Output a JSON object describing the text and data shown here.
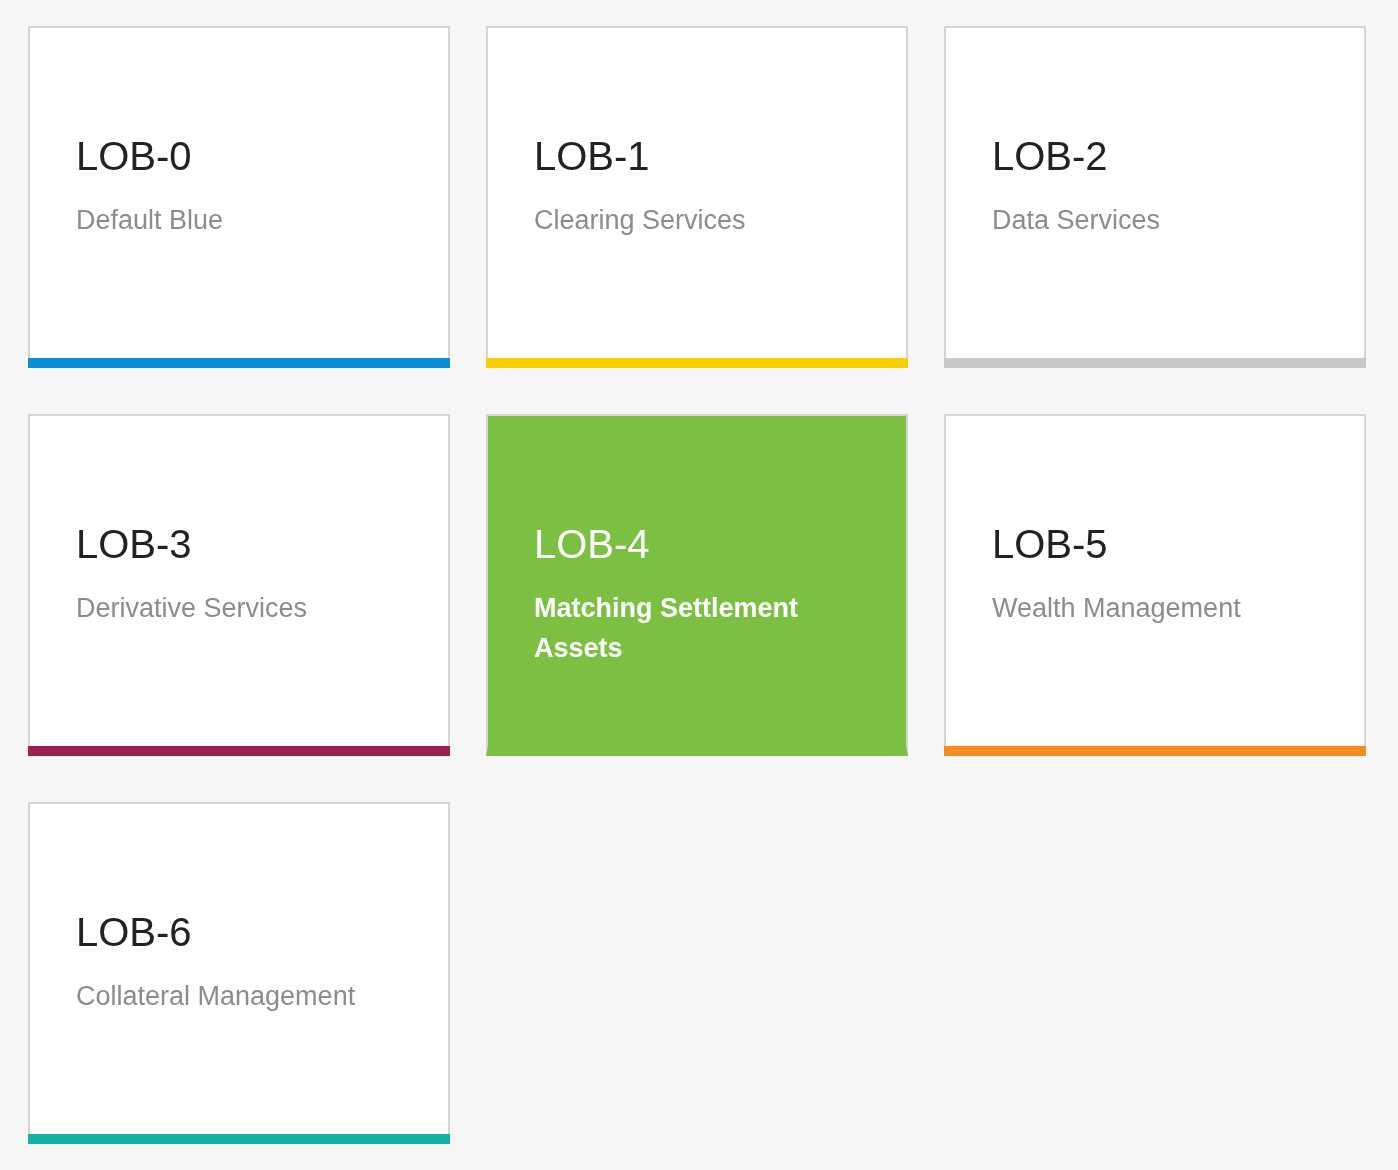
{
  "cards": [
    {
      "title": "LOB-0",
      "subtitle": "Default Blue",
      "color": "#0a8fd6",
      "selected": false
    },
    {
      "title": "LOB-1",
      "subtitle": "Clearing Services",
      "color": "#f9cf00",
      "selected": false
    },
    {
      "title": "LOB-2",
      "subtitle": "Data Services",
      "color": "#c8c8c8",
      "selected": false
    },
    {
      "title": "LOB-3",
      "subtitle": "Derivative Services",
      "color": "#9b2150",
      "selected": false
    },
    {
      "title": "LOB-4",
      "subtitle": "Matching Settlement Assets",
      "color": "#7cc043",
      "selected": true
    },
    {
      "title": "LOB-5",
      "subtitle": "Wealth Management",
      "color": "#f68b1f",
      "selected": false
    },
    {
      "title": "LOB-6",
      "subtitle": "Collateral Management",
      "color": "#14b0a8",
      "selected": false
    }
  ]
}
